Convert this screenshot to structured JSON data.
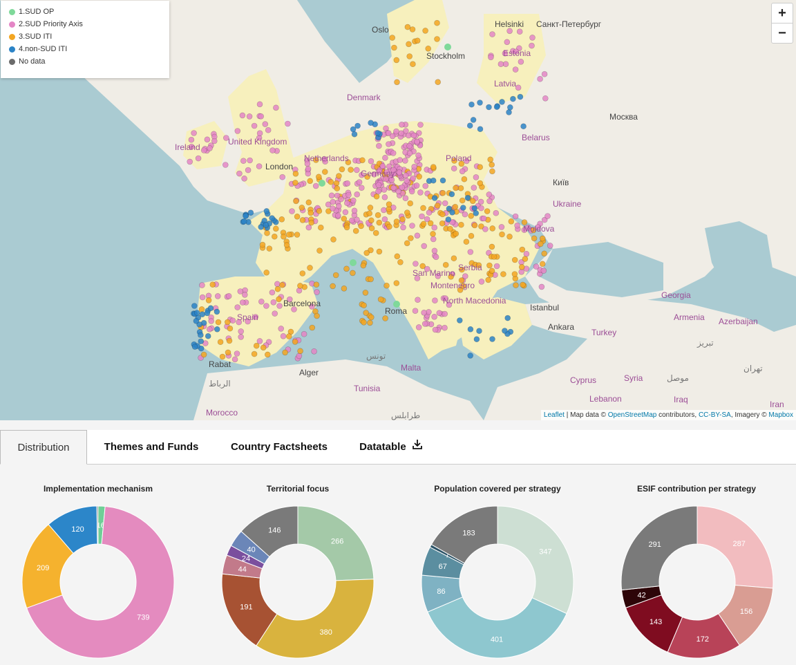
{
  "legend": [
    {
      "label": "1.SUD OP",
      "color": "#7fd99a"
    },
    {
      "label": "2.SUD Priority Axis",
      "color": "#e486c6"
    },
    {
      "label": "3.SUD ITI",
      "color": "#f3a622"
    },
    {
      "label": "4.non-SUD ITI",
      "color": "#2b83c6"
    },
    {
      "label": "No data",
      "color": "#6b6b6b"
    }
  ],
  "zoom": {
    "in": "+",
    "out": "−"
  },
  "attribution": {
    "leaflet": "Leaflet",
    "text1": " | Map data © ",
    "osm": "OpenStreetMap",
    "text2": " contributors, ",
    "license": "CC-BY-SA",
    "text3": ", Imagery © ",
    "mapbox": "Mapbox"
  },
  "map_labels": {
    "countries": [
      "Ireland",
      "United Kingdom",
      "Netherlands",
      "Denmark",
      "Germany",
      "Poland",
      "Belarus",
      "Ukraine",
      "Moldova",
      "Spain",
      "Serbia",
      "Montenegro",
      "North Macedonia",
      "Georgia",
      "Armenia",
      "Azerbaijan",
      "Turkey",
      "Syria",
      "Iraq",
      "Iran",
      "Lebanon",
      "Cyprus",
      "Tunisia",
      "Morocco",
      "Latvia",
      "Estonia",
      "Malta",
      "San Marino"
    ],
    "cities": [
      "Oslo",
      "Stockholm",
      "Helsinki",
      "Санкт-Петербург",
      "Москва",
      "Київ",
      "London",
      "Barcelona",
      "Roma",
      "Istanbul",
      "Ankara",
      "Alger",
      "Rabat",
      "تونس",
      "طرابلس",
      "الرباط",
      "موصل",
      "تبریز",
      "تهران"
    ]
  },
  "tabs": [
    "Distribution",
    "Themes and Funds",
    "Country Factsheets",
    "Datatable"
  ],
  "active_tab": "Distribution",
  "chart_data": [
    {
      "type": "pie",
      "title": "Implementation mechanism",
      "categories": [
        "1.SUD OP",
        "2.SUD Priority Axis",
        "3.SUD ITI",
        "4.non-SUD ITI",
        "No data"
      ],
      "values": [
        16,
        739,
        209,
        120,
        3
      ],
      "colors": [
        "#6fcf97",
        "#e48bbf",
        "#f5b22e",
        "#2c86c9",
        "#7a7a7a"
      ],
      "labels": [
        "16",
        "739",
        "209",
        "120",
        ""
      ],
      "donut": true
    },
    {
      "type": "pie",
      "title": "Territorial focus",
      "values": [
        266,
        380,
        191,
        44,
        24,
        40,
        146
      ],
      "colors": [
        "#a4c9a8",
        "#d9b33e",
        "#a75233",
        "#c27a8a",
        "#7b4f9e",
        "#6b86b8",
        "#7a7a7a"
      ],
      "labels": [
        "266",
        "380",
        "191",
        "44",
        "24",
        "40",
        "146"
      ],
      "donut": true
    },
    {
      "type": "pie",
      "title": "Population covered per strategy",
      "values": [
        347,
        401,
        86,
        67,
        7,
        183
      ],
      "colors": [
        "#cddfd3",
        "#8ec7cf",
        "#7fb2c3",
        "#5b8ea0",
        "#2d5468",
        "#7a7a7a"
      ],
      "labels": [
        "347",
        "401",
        "86",
        "67",
        "7",
        "183"
      ],
      "donut": true
    },
    {
      "type": "pie",
      "title": "ESIF contribution per strategy",
      "values": [
        287,
        156,
        172,
        143,
        42,
        291
      ],
      "colors": [
        "#f2bcbf",
        "#d99d93",
        "#b84358",
        "#7f0c20",
        "#2d0508",
        "#7a7a7a"
      ],
      "labels": [
        "287",
        "156",
        "172",
        "143",
        "42",
        "291"
      ],
      "donut": true
    }
  ]
}
